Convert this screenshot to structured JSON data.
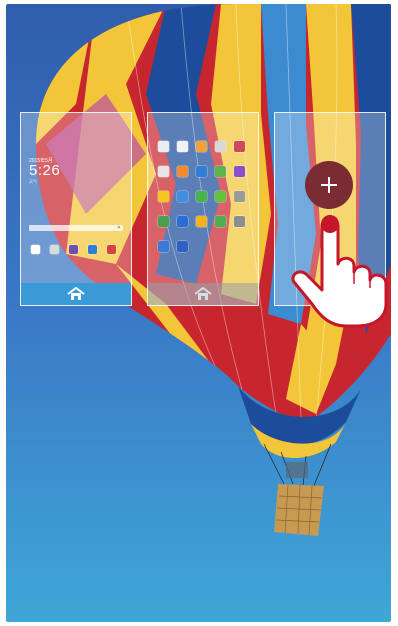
{
  "wallpaper": {
    "sky_top": "#3b6fc0",
    "sky_bottom": "#3d9fcf",
    "balloon_colors": [
      "#c8262f",
      "#f3c63a",
      "#1d4d9a",
      "#3c8ad0",
      "#b84ea0"
    ]
  },
  "screens": [
    {
      "name": "lock-preview",
      "footer": "home-icon",
      "active": true,
      "clock": {
        "date": "2015年5月",
        "time": "5:26",
        "sub": "天气"
      },
      "dock_colors": [
        "#ffffff",
        "#d9d9d9",
        "#6a4fb7",
        "#2d7fd6",
        "#d8443b"
      ]
    },
    {
      "name": "apps-preview",
      "footer": "home-icon",
      "active": false,
      "icon_colors": [
        "#e8eef2",
        "#f3f3f3",
        "#f2a23a",
        "#d8d8d8",
        "#d0465a",
        "#e6e6e6",
        "#f28b2d",
        "#2f7fd8",
        "#5ab54b",
        "#8c4ed1",
        "#f7c520",
        "#3e8fe0",
        "#48b54c",
        "#66c23e",
        "#9b9b9b",
        "#4aa04a",
        "#2a6ed3",
        "#f1b21e",
        "#4cb050",
        "#8d8d8d",
        "#3c78d8",
        "#2d62c4"
      ]
    },
    {
      "name": "add-screen",
      "footer": "",
      "active": false,
      "add_color": "#7b2b33"
    }
  ],
  "gesture": {
    "icon": "tap-hand-icon",
    "color": "#c5172b"
  }
}
